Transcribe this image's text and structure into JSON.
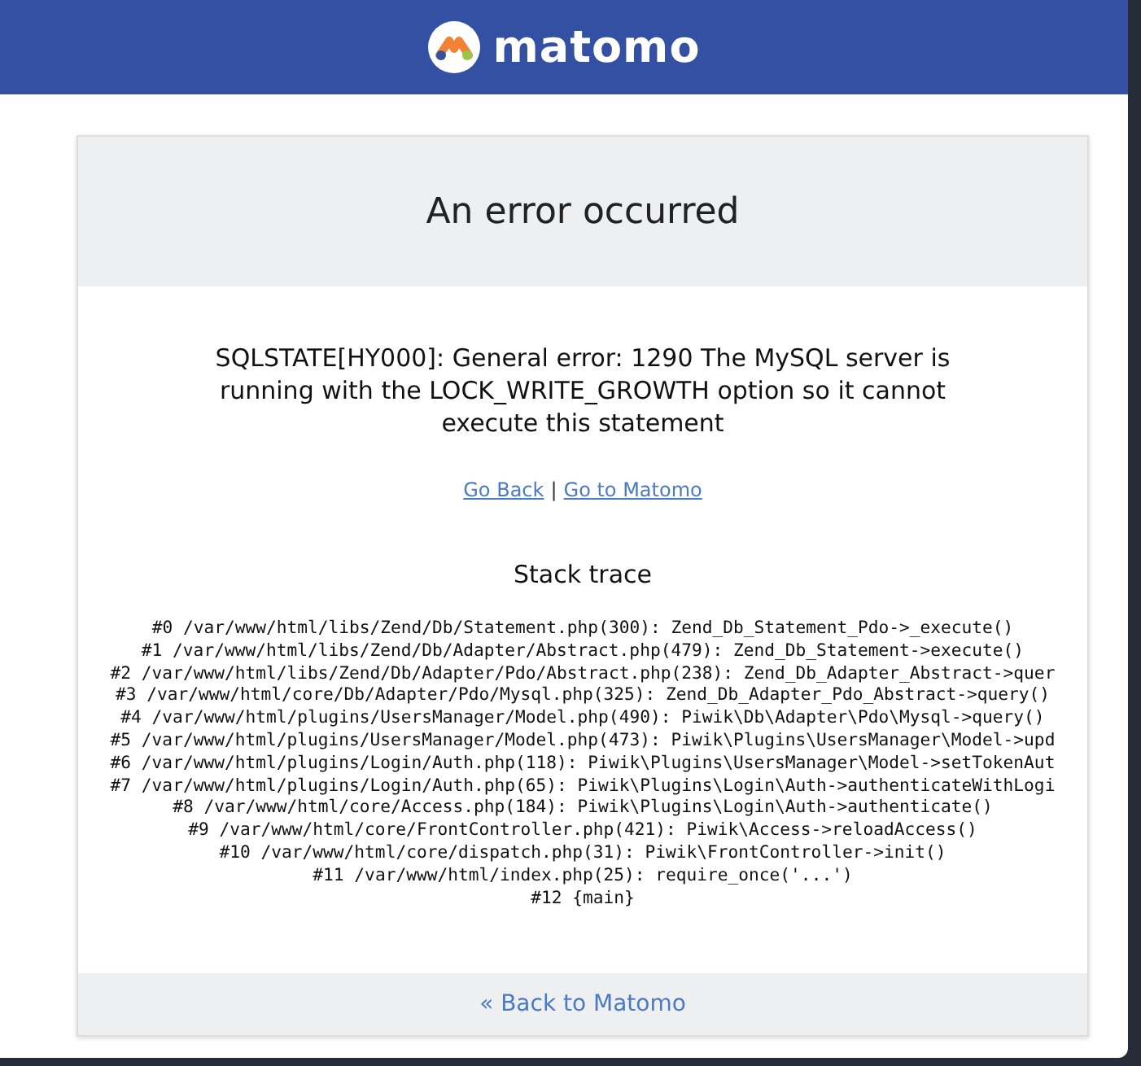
{
  "header": {
    "brand": "matomo"
  },
  "error": {
    "title": "An error occurred",
    "message": "SQLSTATE[HY000]: General error: 1290 The MySQL server is running with the LOCK_WRITE_GROWTH option so it cannot execute this statement",
    "links": [
      {
        "label": "Go Back"
      },
      {
        "label": "Go to Matomo"
      }
    ],
    "separator": "|"
  },
  "stack_trace": {
    "title": "Stack trace",
    "lines": [
      "#0 /var/www/html/libs/Zend/Db/Statement.php(300): Zend_Db_Statement_Pdo->_execute()",
      "#1 /var/www/html/libs/Zend/Db/Adapter/Abstract.php(479): Zend_Db_Statement->execute()",
      "#2 /var/www/html/libs/Zend/Db/Adapter/Pdo/Abstract.php(238): Zend_Db_Adapter_Abstract->quer",
      "#3 /var/www/html/core/Db/Adapter/Pdo/Mysql.php(325): Zend_Db_Adapter_Pdo_Abstract->query()",
      "#4 /var/www/html/plugins/UsersManager/Model.php(490): Piwik\\Db\\Adapter\\Pdo\\Mysql->query()",
      "#5 /var/www/html/plugins/UsersManager/Model.php(473): Piwik\\Plugins\\UsersManager\\Model->upd",
      "#6 /var/www/html/plugins/Login/Auth.php(118): Piwik\\Plugins\\UsersManager\\Model->setTokenAut",
      "#7 /var/www/html/plugins/Login/Auth.php(65): Piwik\\Plugins\\Login\\Auth->authenticateWithLogi",
      "#8 /var/www/html/core/Access.php(184): Piwik\\Plugins\\Login\\Auth->authenticate()",
      "#9 /var/www/html/core/FrontController.php(421): Piwik\\Access->reloadAccess()",
      "#10 /var/www/html/core/dispatch.php(31): Piwik\\FrontController->init()",
      "#11 /var/www/html/index.php(25): require_once('...')",
      "#12 {main}"
    ]
  },
  "footer": {
    "link": "« Back to Matomo"
  }
}
